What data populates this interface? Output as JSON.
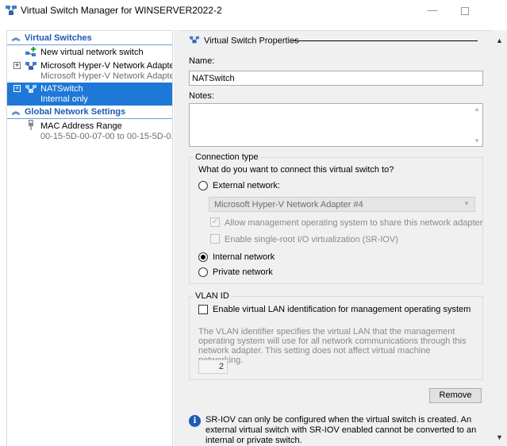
{
  "window": {
    "title": "Virtual Switch Manager for WINSERVER2022-2"
  },
  "left_panel": {
    "virtual_switches_header": "Virtual Switches",
    "items": [
      {
        "line1": "New virtual network switch"
      },
      {
        "line1": "Microsoft Hyper-V Network Adapte...",
        "line2": "Microsoft Hyper-V Network Adapte..."
      },
      {
        "line1": "NATSwitch",
        "line2": "Internal only"
      }
    ],
    "global_header": "Global Network Settings",
    "mac": {
      "line1": "MAC Address Range",
      "line2": "00-15-5D-00-07-00 to 00-15-5D-0..."
    }
  },
  "properties": {
    "header": "Virtual Switch Properties",
    "name_label": "Name:",
    "name_value": "NATSwitch",
    "notes_label": "Notes:",
    "notes_value": ""
  },
  "connection": {
    "group_title": "Connection type",
    "question": "What do you want to connect this virtual switch to?",
    "external_label": "External network:",
    "adapter_selected": "Microsoft Hyper-V Network Adapter #4",
    "allow_mgmt_label": "Allow management operating system to share this network adapter",
    "sriov_label": "Enable single-root I/O virtualization (SR-IOV)",
    "internal_label": "Internal network",
    "private_label": "Private network",
    "selected": "internal"
  },
  "vlan": {
    "group_title": "VLAN ID",
    "enable_label": "Enable virtual LAN identification for management operating system",
    "description": "The VLAN identifier specifies the virtual LAN that the management operating system will use for all network communications through this network adapter. This setting does not affect virtual machine networking.",
    "id_value": "2"
  },
  "actions": {
    "remove_label": "Remove"
  },
  "info": {
    "text": "SR-IOV can only be configured when the virtual switch is created. An external virtual switch with SR-IOV enabled cannot be converted to an internal or private switch."
  },
  "colors": {
    "accent": "#1e78d7",
    "header_text": "#1a5bb5",
    "panel_bg": "#f0f0f0"
  }
}
